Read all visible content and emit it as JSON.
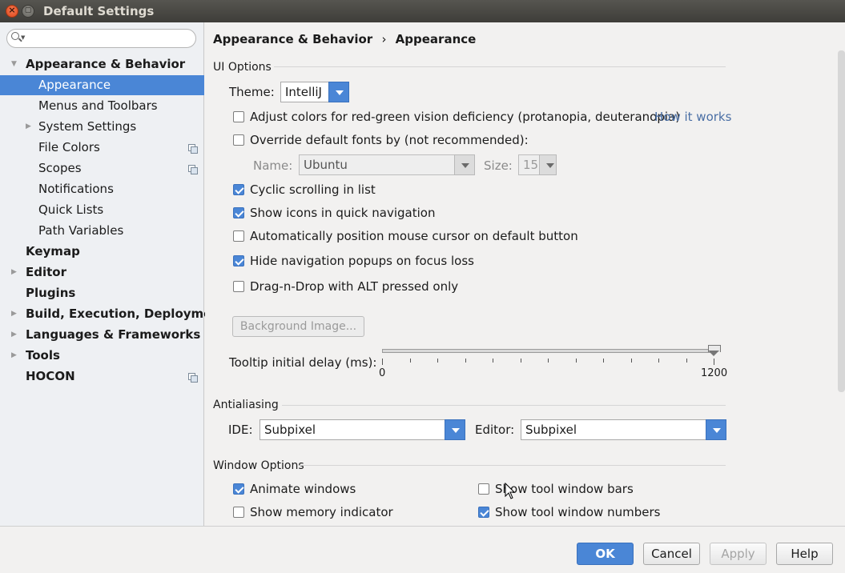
{
  "window": {
    "title": "Default Settings"
  },
  "search": {
    "placeholder": ""
  },
  "sidebar": {
    "items": [
      {
        "label": "Appearance & Behavior",
        "expanded": true
      },
      {
        "label": "Appearance",
        "selected": true
      },
      {
        "label": "Menus and Toolbars"
      },
      {
        "label": "System Settings"
      },
      {
        "label": "File Colors"
      },
      {
        "label": "Scopes"
      },
      {
        "label": "Notifications"
      },
      {
        "label": "Quick Lists"
      },
      {
        "label": "Path Variables"
      },
      {
        "label": "Keymap"
      },
      {
        "label": "Editor"
      },
      {
        "label": "Plugins"
      },
      {
        "label": "Build, Execution, Deployment"
      },
      {
        "label": "Languages & Frameworks"
      },
      {
        "label": "Tools"
      },
      {
        "label": "HOCON"
      }
    ]
  },
  "breadcrumb": {
    "parent": "Appearance & Behavior",
    "separator": "›",
    "current": "Appearance"
  },
  "ui_options": {
    "section": "UI Options",
    "theme_label": "Theme:",
    "theme_value": "IntelliJ",
    "adjust_colors": {
      "label": "Adjust colors for red-green vision deficiency (protanopia, deuteranopia)",
      "checked": false
    },
    "how_it_works": "How it works",
    "override_fonts": {
      "label": "Override default fonts by (not recommended):",
      "checked": false
    },
    "name_label": "Name:",
    "name_value": "Ubuntu",
    "size_label": "Size:",
    "size_value": "15",
    "cyclic_scrolling": {
      "label": "Cyclic scrolling in list",
      "checked": true
    },
    "show_icons": {
      "label": "Show icons in quick navigation",
      "checked": true
    },
    "auto_position": {
      "label": "Automatically position mouse cursor on default button",
      "checked": false
    },
    "hide_popups": {
      "label": "Hide navigation popups on focus loss",
      "checked": true
    },
    "drag_drop": {
      "label": "Drag-n-Drop with ALT pressed only",
      "checked": false
    },
    "background_image": "Background Image...",
    "tooltip_label": "Tooltip initial delay (ms):",
    "tooltip_min": "0",
    "tooltip_max": "1200",
    "tooltip_value_fraction": 1.0
  },
  "antialiasing": {
    "section": "Antialiasing",
    "ide_label": "IDE:",
    "ide_value": "Subpixel",
    "editor_label": "Editor:",
    "editor_value": "Subpixel"
  },
  "window_options": {
    "section": "Window Options",
    "animate_windows": {
      "label": "Animate windows",
      "checked": true
    },
    "show_memory": {
      "label": "Show memory indicator",
      "checked": false
    },
    "show_tool_bars": {
      "label": "Show tool window bars",
      "checked": false
    },
    "show_tool_numbers": {
      "label": "Show tool window numbers",
      "checked": true
    }
  },
  "footer": {
    "ok": "OK",
    "cancel": "Cancel",
    "apply": "Apply",
    "help": "Help"
  },
  "colors": {
    "accent": "#4a86d6",
    "titlebar": "#3e3d39",
    "sidebar_bg": "#eef0f3"
  }
}
